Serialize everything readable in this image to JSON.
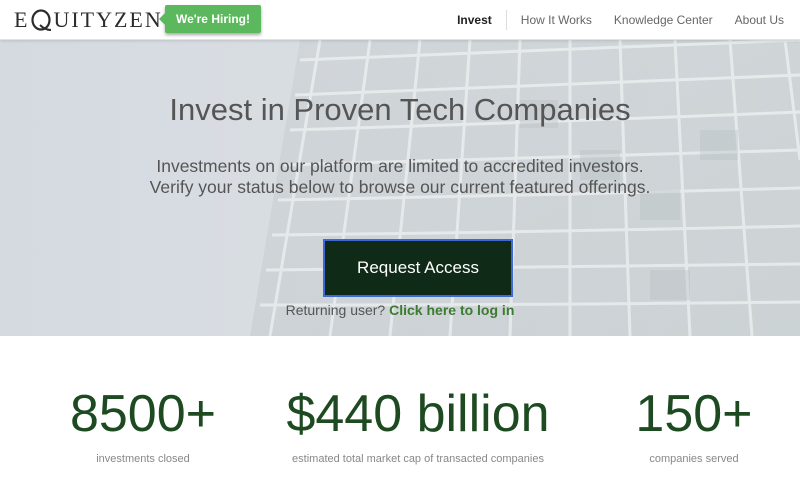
{
  "header": {
    "logo_prefix": "E",
    "logo_suffix": "UITYZEN",
    "logo_q_letter": "Q",
    "hiring_label": "We're Hiring!",
    "nav": [
      {
        "label": "Invest",
        "active": true
      },
      {
        "label": "How It Works",
        "active": false
      },
      {
        "label": "Knowledge Center",
        "active": false
      },
      {
        "label": "About Us",
        "active": false
      }
    ]
  },
  "hero": {
    "title": "Invest in Proven Tech Companies",
    "subtitle_line1": "Investments on our platform are limited to accredited investors.",
    "subtitle_line2": "Verify your status below to browse our current featured offerings.",
    "cta_label": "Request Access",
    "returning_text": "Returning user?",
    "login_link": "Click here to log in"
  },
  "stats": [
    {
      "value": "8500+",
      "label": "investments closed"
    },
    {
      "value": "$440 billion",
      "label": "estimated total market cap of transacted companies"
    },
    {
      "value": "150+",
      "label": "companies served"
    }
  ],
  "colors": {
    "brand_green": "#1e4a22",
    "hiring_green": "#5cb85c",
    "cta_bg": "#0f2a17",
    "cta_border": "#3d68d6",
    "link_green": "#3d7a32"
  }
}
